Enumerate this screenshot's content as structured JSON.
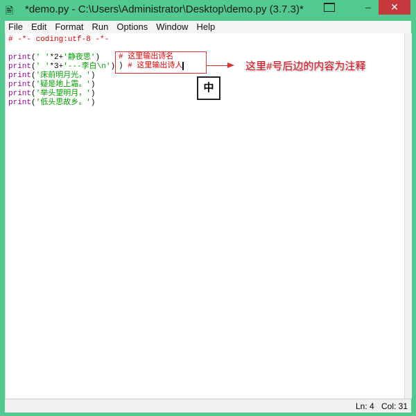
{
  "window": {
    "title": "*demo.py - C:\\Users\\Administrator\\Desktop\\demo.py (3.7.3)*",
    "minimize": "–",
    "close": "✕"
  },
  "menu": [
    "File",
    "Edit",
    "Format",
    "Run",
    "Options",
    "Window",
    "Help"
  ],
  "code": {
    "line0": "# -*- coding:utf-8 -*-",
    "lines": [
      {
        "fn": "print",
        "open": "(",
        "str": "' '",
        "rest": "*2+",
        "str2": "'静夜思'",
        "close": ")"
      },
      {
        "fn": "print",
        "open": "(",
        "str": "' '",
        "rest": "*3+",
        "str2": "'---李白\\n'",
        "close": ")"
      },
      {
        "fn": "print",
        "open": "(",
        "str": "'床前明月光，'",
        "close": ")"
      },
      {
        "fn": "print",
        "open": "(",
        "str": "'疑是地上霜。'",
        "close": ")"
      },
      {
        "fn": "print",
        "open": "(",
        "str": "'举头望明月，'",
        "close": ")"
      },
      {
        "fn": "print",
        "open": "(",
        "str": "'低头思故乡。'",
        "close": ")"
      }
    ],
    "comment1": "# 这里输出诗名",
    "comment2_prefix": ")",
    "comment2": " # 这里输出诗人"
  },
  "annotation": "这里#号后边的内容为注释",
  "ime_indicator": "中",
  "status": {
    "ln": "Ln: 4",
    "col": "Col: 31"
  },
  "colors": {
    "border": "#52c98e",
    "keyword": "#900090",
    "string": "#00a000",
    "comment": "#dd0000",
    "annotation": "#e01020"
  }
}
